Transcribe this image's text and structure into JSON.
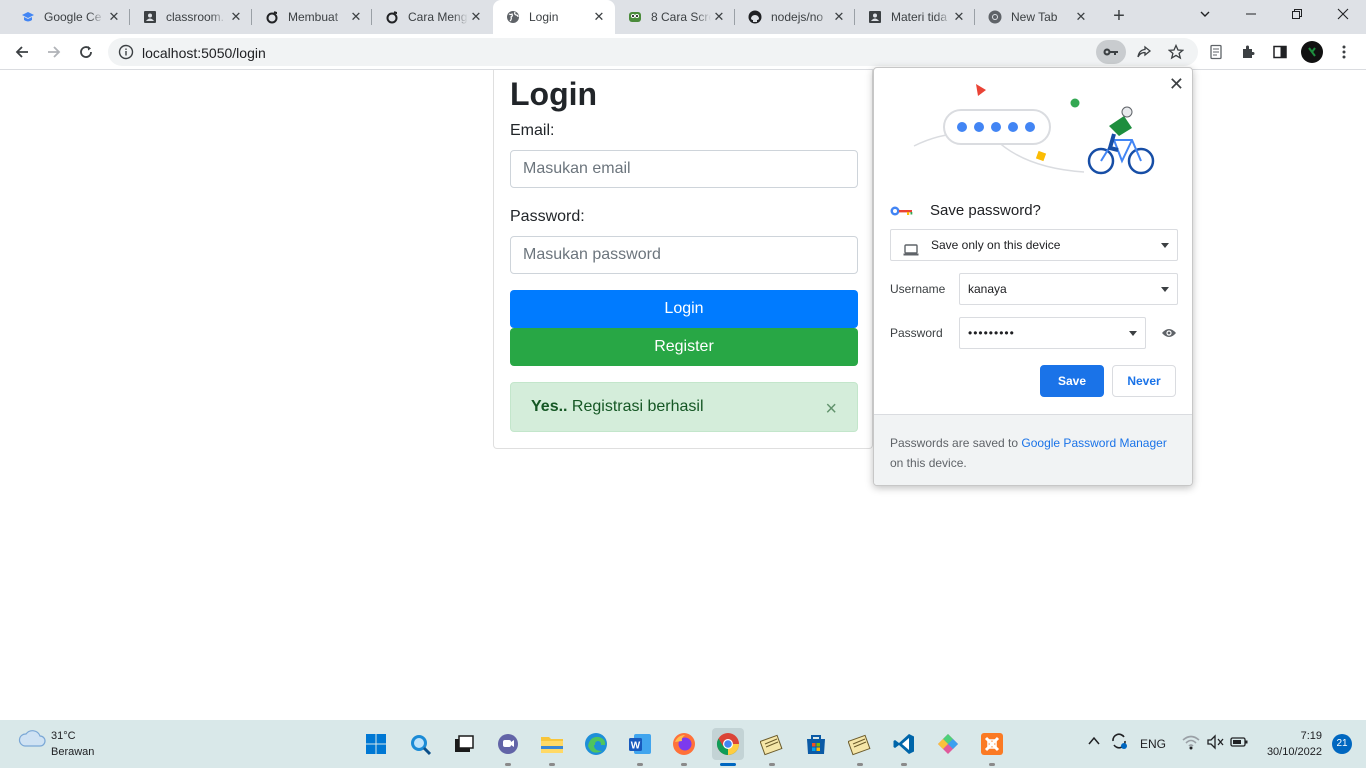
{
  "browser": {
    "tabs": [
      {
        "title": "Google Ce",
        "icon": "google-classroom-icon"
      },
      {
        "title": "classroom.",
        "icon": "profile-icon"
      },
      {
        "title": "Membuat",
        "icon": "tiktok-icon"
      },
      {
        "title": "Cara Meng",
        "icon": "tiktok-icon"
      },
      {
        "title": "Login",
        "icon": "globe-icon"
      },
      {
        "title": "8 Cara Scre",
        "icon": "toaster-icon"
      },
      {
        "title": "nodejs/no",
        "icon": "github-icon"
      },
      {
        "title": "Materi tida",
        "icon": "profile-icon"
      },
      {
        "title": "New Tab",
        "icon": "chrome-icon"
      }
    ],
    "url": "localhost:5050/login"
  },
  "page": {
    "title": "Login",
    "email_label": "Email:",
    "email_placeholder": "Masukan email",
    "password_label": "Password:",
    "password_placeholder": "Masukan password",
    "login_button": "Login",
    "register_button": "Register",
    "alert_strong": "Yes..",
    "alert_text": " Registrasi berhasil",
    "alert_close": "×"
  },
  "popup": {
    "title": "Save password?",
    "location": "Save only on this device",
    "username_label": "Username",
    "username_value": "kanaya",
    "password_label": "Password",
    "password_value": "•••••••••",
    "save_button": "Save",
    "never_button": "Never",
    "footer_pre": "Passwords are saved to ",
    "footer_link": "Google Password Manager",
    "footer_post": " on this device."
  },
  "taskbar": {
    "weather_temp": "31°C",
    "weather_cond": "Berawan",
    "language": "ENG",
    "time": "7:19",
    "date": "30/10/2022",
    "notifications": "21"
  },
  "colors": {
    "primary": "#007bff",
    "success": "#28a745",
    "alert_bg": "#d4edda",
    "chrome_blue": "#1a73e8"
  }
}
